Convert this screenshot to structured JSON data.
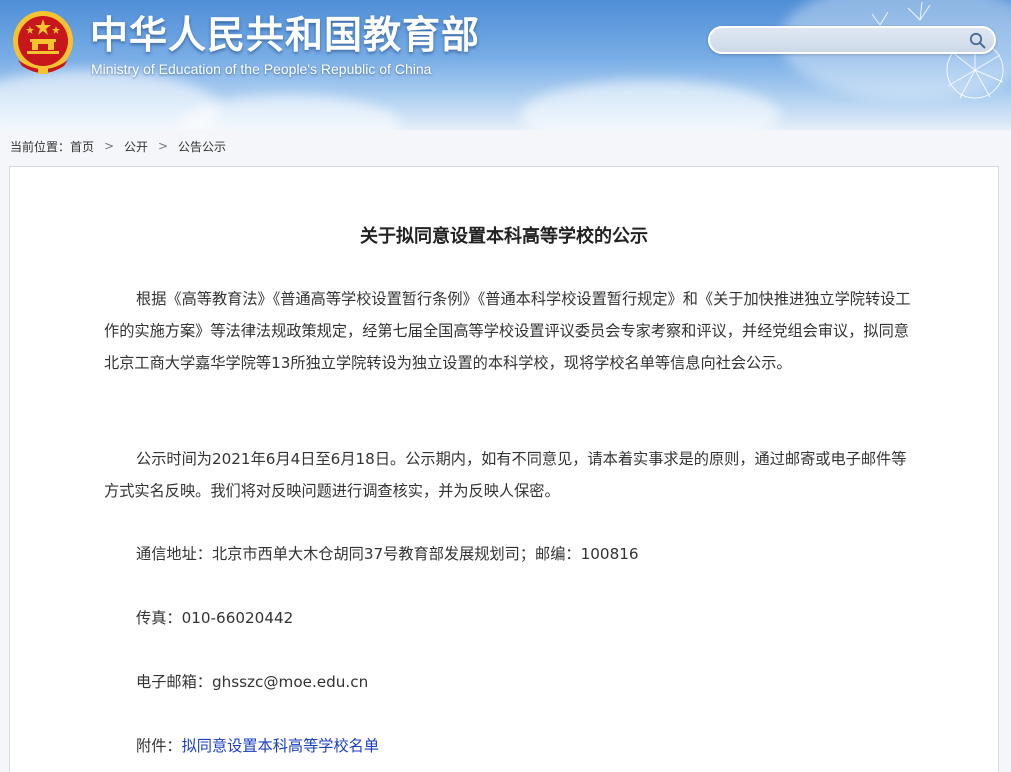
{
  "header": {
    "title_cn": "中华人民共和国教育部",
    "title_en": "Ministry of Education of the People's Republic of China",
    "search": {
      "value": "",
      "placeholder": ""
    }
  },
  "breadcrumb": {
    "prefix": "当前位置：",
    "items": [
      {
        "label": "首页"
      },
      {
        "label": "公开"
      },
      {
        "label": "公告公示"
      }
    ],
    "separator": ">"
  },
  "article": {
    "title": "关于拟同意设置本科高等学校的公示",
    "paragraphs": [
      "根据《高等教育法》《普通高等学校设置暂行条例》《普通本科学校设置暂行规定》和《关于加快推进独立学院转设工作的实施方案》等法律法规政策规定，经第七届全国高等学校设置评议委员会专家考察和评议，并经党组会审议，拟同意北京工商大学嘉华学院等13所独立学院转设为独立设置的本科学校，现将学校名单等信息向社会公示。",
      "公示时间为2021年6月4日至6月18日。公示期内，如有不同意见，请本着实事求是的原则，通过邮寄或电子邮件等方式实名反映。我们将对反映问题进行调查核实，并为反映人保密。"
    ],
    "contact": {
      "address": "通信地址：北京市西单大木仓胡同37号教育部发展规划司；邮编：100816",
      "fax": "传真：010-66020442",
      "email": "电子邮箱：ghsszc@moe.edu.cn",
      "attachment_label": "附件：",
      "attachment_link": "拟同意设置本科高等学校名单"
    }
  },
  "colors": {
    "header_top": "#4f8ed6",
    "header_bottom": "#e6eff9",
    "link": "#1a3fbf",
    "emblem_red": "#c8161d",
    "emblem_gold": "#f4c430"
  },
  "icons": {
    "emblem": "national-emblem-icon",
    "search": "search-icon",
    "separator": "chevron-right-icon"
  }
}
